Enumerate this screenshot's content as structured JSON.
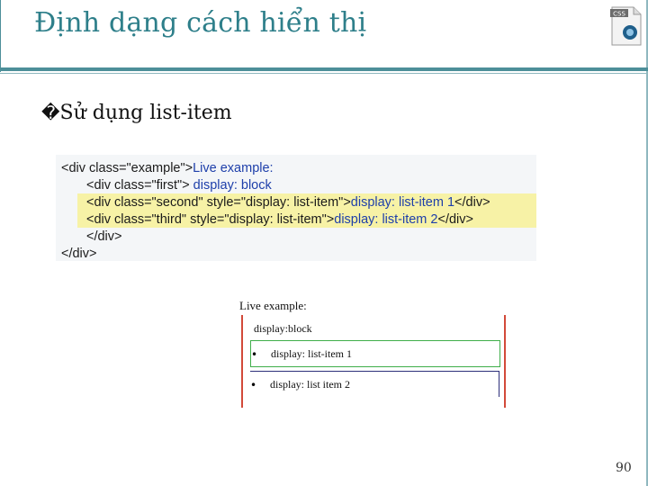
{
  "slide": {
    "title": "Định dạng cách hiển thị",
    "bullet_marker": "�",
    "bullet_text": "Sử dụng list-item",
    "page_number": "90",
    "icon_label": "CSS"
  },
  "code": {
    "lines": [
      {
        "tag": "<div class=\"example\">",
        "text": "Live example:"
      },
      {
        "tag": "<div class=\"first\">",
        "text": " display: block"
      },
      {
        "tag": "<div class=\"second\" style=\"display: list-item\">",
        "text": "display: list-item 1",
        "tail": "</div>"
      },
      {
        "tag": "<div class=\"third\" style=\"display: list-item\">",
        "text": "display: list-item 2",
        "tail": "</div>"
      },
      {
        "tag": "</div>",
        "text": ""
      },
      {
        "tag": "</div>",
        "text": ""
      }
    ]
  },
  "demo": {
    "label": "Live example:",
    "block_text": "display:block",
    "item1": "display: list-item 1",
    "item2": "display: list item 2",
    "bullet": "•"
  },
  "colors": {
    "title": "#2e7f8a",
    "rule": "#4d8f99",
    "highlight": "#f7f2a6",
    "code_value": "#1e3faa",
    "demo_border_red": "#d24a3a",
    "demo_border_green": "#3fae49",
    "demo_border_navy": "#2d2f7a"
  }
}
